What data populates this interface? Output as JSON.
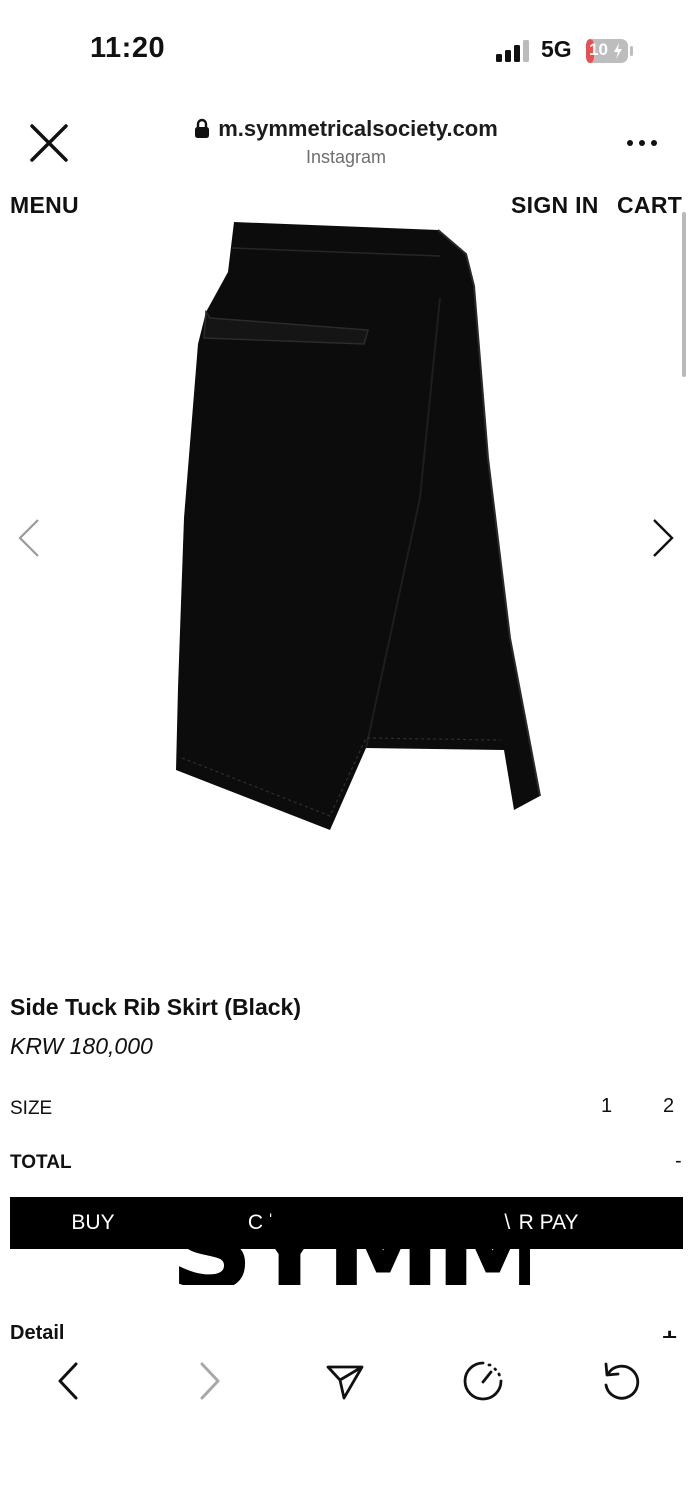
{
  "status_bar": {
    "time": "11:20",
    "network": "5G",
    "battery": "10"
  },
  "browser": {
    "url": "m.symmetricalsociety.com",
    "referrer": "Instagram",
    "icons": [
      "close-icon",
      "lock-icon",
      "more-icon"
    ]
  },
  "nav": {
    "menu": "MENU",
    "sign_in": "SIGN IN",
    "cart": "CART"
  },
  "product": {
    "name": "Side Tuck Rib Skirt (Black)",
    "price": "KRW 180,000",
    "size_label": "SIZE",
    "sizes": [
      "1",
      "2"
    ],
    "total_label": "TOTAL",
    "total_value": "-",
    "image_color": "#0c0c0c"
  },
  "actions": {
    "buy": "BUY",
    "cart": "C ˈ",
    "pay": "\\  R PAY",
    "overlay_logo": "SYMM"
  },
  "detail": {
    "label": "Detail",
    "toggle": "+"
  },
  "toolbar": {
    "icons": [
      "back-icon",
      "forward-icon",
      "share-icon",
      "speed-icon",
      "reload-icon"
    ]
  },
  "colors": {
    "accent": "#000000",
    "battery": "#e85050",
    "muted": "#6f6f6f"
  }
}
